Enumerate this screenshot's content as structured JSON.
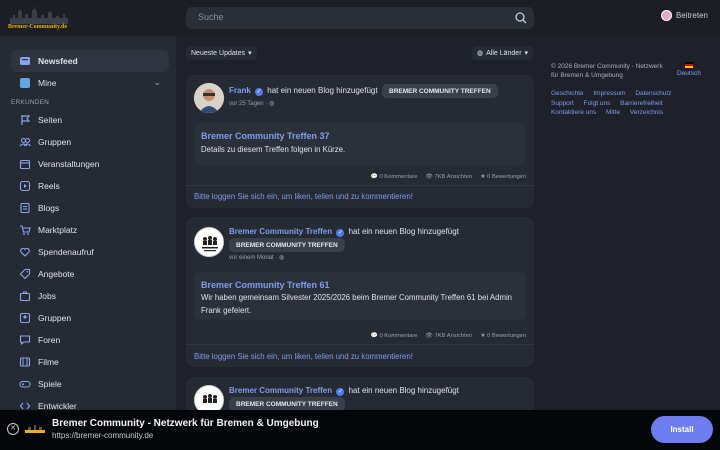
{
  "header": {
    "logo_text": "Bremer-Community.de",
    "search_placeholder": "Suche",
    "join_label": "Beitreten"
  },
  "sidebar": {
    "newsfeed": "Newsfeed",
    "mine": "Mine",
    "section_label": "ERKUNDEN",
    "items": [
      {
        "label": "Seiten",
        "icon": "flag-icon"
      },
      {
        "label": "Gruppen",
        "icon": "users-icon"
      },
      {
        "label": "Veranstaltungen",
        "icon": "calendar-icon"
      },
      {
        "label": "Reels",
        "icon": "reel-icon"
      },
      {
        "label": "Blogs",
        "icon": "blog-icon"
      },
      {
        "label": "Marktplatz",
        "icon": "cart-icon"
      },
      {
        "label": "Spendenaufruf",
        "icon": "donate-icon"
      },
      {
        "label": "Angebote",
        "icon": "offer-icon"
      },
      {
        "label": "Jobs",
        "icon": "briefcase-icon"
      },
      {
        "label": "Gruppen",
        "icon": "group-icon"
      },
      {
        "label": "Foren",
        "icon": "forum-icon"
      },
      {
        "label": "Filme",
        "icon": "film-icon"
      },
      {
        "label": "Spiele",
        "icon": "game-icon"
      },
      {
        "label": "Entwickler",
        "icon": "code-icon"
      }
    ]
  },
  "filters": {
    "sort": "Neueste Updates",
    "country": "Alle Länder"
  },
  "posts": [
    {
      "author": "Frank",
      "action": "hat ein neuen Blog hinzugefügt",
      "tag": "BREMER COMMUNITY TREFFEN",
      "time": "vor 25 Tagen",
      "title": "Bremer Community Treffen 37",
      "desc": "Details zu diesem Treffen folgen in Kürze.",
      "comments": "0 Kommentare",
      "views": "7KB Ansichten",
      "ratings": "0 Bewertungen",
      "login": "Bitte loggen Sie sich ein, um liken, teilen und zu kommentieren!"
    },
    {
      "author": "Bremer Community Treffen",
      "action": "hat ein neuen Blog hinzugefügt",
      "tag": "BREMER COMMUNITY TREFFEN",
      "time": "vor einem Monat",
      "title": "Bremer Community Treffen 61",
      "desc": "Wir haben gemeinsam Silvester 2025/2026 beim Bremer Community Treffen 61 bei Admin Frank gefeiert.",
      "comments": "0 Kommentare",
      "views": "7KB Ansichten",
      "ratings": "0 Bewertungen",
      "login": "Bitte loggen Sie sich ein, um liken, teilen und zu kommentieren!"
    },
    {
      "author": "Bremer Community Treffen",
      "action": "hat ein neuen Blog hinzugefügt",
      "tag": "BREMER COMMUNITY TREFFEN"
    }
  ],
  "right": {
    "copyright": "© 2026 Bremer Community - Netzwerk für Bremen & Umgebung",
    "language": "Deutsch",
    "links": [
      "Geschichte",
      "Impressum",
      "Datenschutz",
      "Support",
      "Folgt uns",
      "Barrierefreiheit",
      "Kontaktiere uns",
      "Mitte",
      "Verzeichnis"
    ]
  },
  "banner": {
    "title": "Bremer Community - Netzwerk für Bremen & Umgebung",
    "url": "https://bremer-community.de",
    "install": "Install"
  }
}
